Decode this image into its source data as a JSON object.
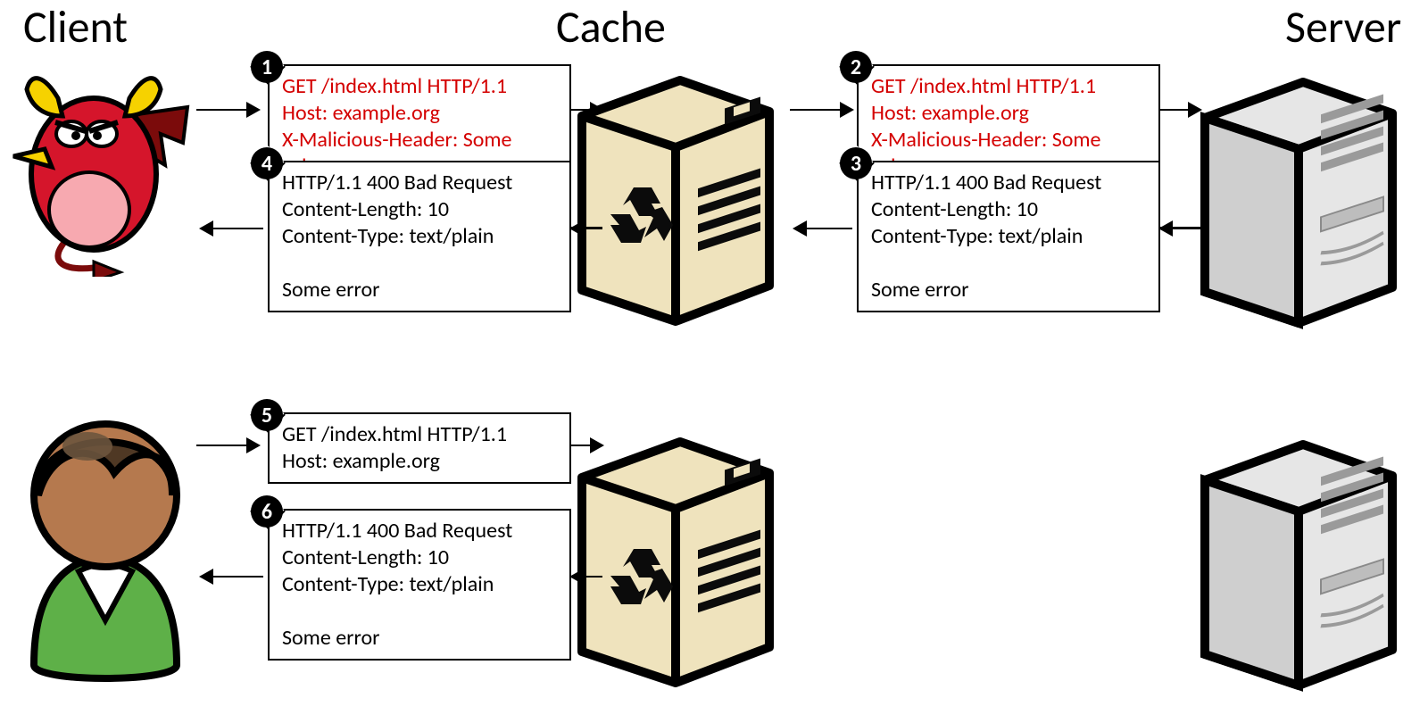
{
  "headings": {
    "client": "Client",
    "cache": "Cache",
    "server": "Server"
  },
  "messages": {
    "m1": {
      "num": "1",
      "lines": [
        "GET /index.html HTTP/1.1",
        "Host: example.org",
        "X-Malicious-Header: Some value"
      ],
      "red": true
    },
    "m2": {
      "num": "2",
      "lines": [
        "GET /index.html HTTP/1.1",
        "Host: example.org",
        "X-Malicious-Header: Some value"
      ],
      "red": true
    },
    "m3": {
      "num": "3",
      "lines": [
        "HTTP/1.1 400 Bad Request",
        "Content-Length: 10",
        "Content-Type: text/plain",
        "",
        "Some error"
      ]
    },
    "m4": {
      "num": "4",
      "lines": [
        "HTTP/1.1 400 Bad Request",
        "Content-Length: 10",
        "Content-Type: text/plain",
        "",
        "Some error"
      ]
    },
    "m5": {
      "num": "5",
      "lines": [
        "GET /index.html HTTP/1.1",
        "Host: example.org"
      ]
    },
    "m6": {
      "num": "6",
      "lines": [
        "HTTP/1.1 400 Bad Request",
        "Content-Length: 10",
        "Content-Type: text/plain",
        "",
        "Some error"
      ]
    }
  }
}
